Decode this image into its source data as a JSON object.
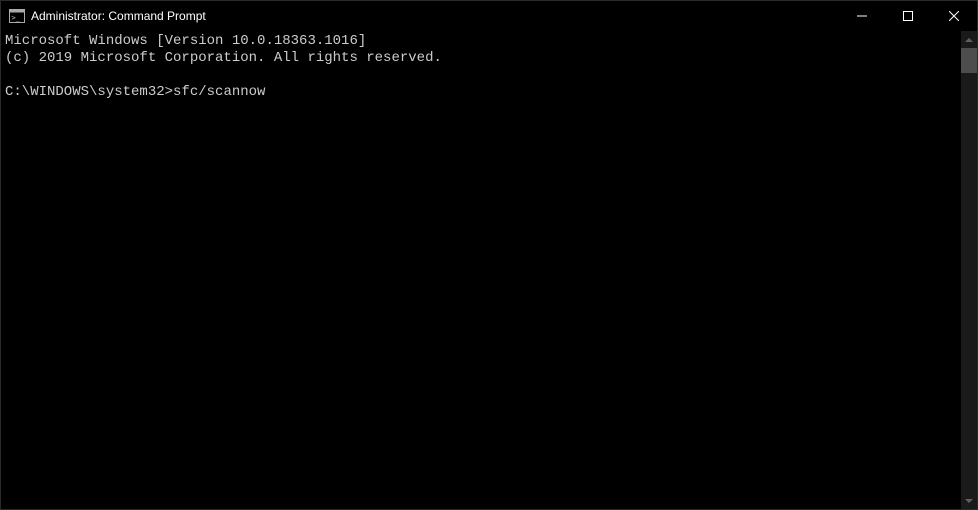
{
  "titlebar": {
    "title": "Administrator: Command Prompt"
  },
  "terminal": {
    "line1": "Microsoft Windows [Version 10.0.18363.1016]",
    "line2": "(c) 2019 Microsoft Corporation. All rights reserved.",
    "blank": "",
    "prompt": "C:\\WINDOWS\\system32>",
    "command": "sfc/scannow"
  }
}
